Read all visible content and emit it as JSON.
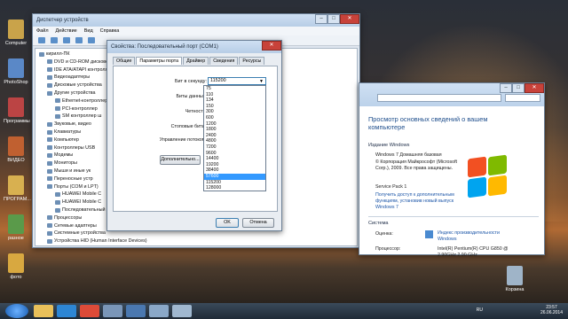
{
  "desktop": {
    "icons": [
      {
        "label": "Computer",
        "color": "#c9a34a"
      },
      {
        "label": "PhotoShop",
        "color": "#5a88c7"
      },
      {
        "label": "Программы",
        "color": "#b44"
      },
      {
        "label": "ВИДЕО",
        "color": "#c06030"
      },
      {
        "label": "ПРОГРАМ...",
        "color": "#d8b050"
      },
      {
        "label": "разное",
        "color": "#5a9a4a"
      },
      {
        "label": "фото",
        "color": "#d8a840"
      }
    ],
    "recycle": "Корзина"
  },
  "device_manager": {
    "title": "Диспетчер устройств",
    "menu": [
      "Файл",
      "Действие",
      "Вид",
      "Справка"
    ],
    "tree": [
      {
        "t": "кирилл-ПК",
        "d": 0
      },
      {
        "t": "DVD и CD-ROM дисководы",
        "d": 1
      },
      {
        "t": "IDE ATA/ATAPI контроллеры",
        "d": 1
      },
      {
        "t": "Видеоадаптеры",
        "d": 1
      },
      {
        "t": "Дисковые устройства",
        "d": 1
      },
      {
        "t": "Другие устройства",
        "d": 1
      },
      {
        "t": "Ethernet-контроллер",
        "d": 2
      },
      {
        "t": "PCI-контроллер",
        "d": 2
      },
      {
        "t": "SM контроллер ш",
        "d": 2
      },
      {
        "t": "Звуковые, видео",
        "d": 1
      },
      {
        "t": "Клавиатуры",
        "d": 1
      },
      {
        "t": "Компьютер",
        "d": 1
      },
      {
        "t": "Контроллеры USB",
        "d": 1
      },
      {
        "t": "Модемы",
        "d": 1
      },
      {
        "t": "Мониторы",
        "d": 1
      },
      {
        "t": "Мыши и иные ук",
        "d": 1
      },
      {
        "t": "Переносные устр",
        "d": 1
      },
      {
        "t": "Порты (COM и LPT)",
        "d": 1
      },
      {
        "t": "HUAWEI Mobile C",
        "d": 2
      },
      {
        "t": "HUAWEI Mobile C",
        "d": 2
      },
      {
        "t": "Последовательный",
        "d": 2
      },
      {
        "t": "Процессоры",
        "d": 1
      },
      {
        "t": "Сетевые адаптеры",
        "d": 1
      },
      {
        "t": "Системные устройства",
        "d": 1
      },
      {
        "t": "Устройства HID (Human Interface Devices)",
        "d": 1
      }
    ]
  },
  "props": {
    "title": "Свойства: Последовательный порт (COM1)",
    "tabs": [
      "Общие",
      "Параметры порта",
      "Драйвер",
      "Сведения",
      "Ресурсы"
    ],
    "labels": {
      "bps": "Бит в секунду:",
      "data": "Биты данных:",
      "parity": "Четность:",
      "stop": "Стоповые биты:",
      "flow": "Управление потоком:"
    },
    "bps_value": "115200",
    "advanced": "Дополнительно...",
    "ok": "OK",
    "cancel": "Отмена",
    "options": [
      "75",
      "110",
      "134",
      "150",
      "300",
      "600",
      "1200",
      "1800",
      "2400",
      "4800",
      "7200",
      "9600",
      "14400",
      "19200",
      "38400",
      "57600",
      "115200",
      "128000"
    ],
    "selected_index": 15
  },
  "system": {
    "heading": "Просмотр основных сведений о вашем компьютере",
    "edition_h": "Издание Windows",
    "edition": "Windows 7 Домашняя базовая",
    "copyright": "© Корпорация Майкрософт (Microsoft Corp.), 2009. Все права защищены.",
    "sp": "Service Pack 1",
    "more": "Получить доступ к дополнительным функциям, установив новый выпуск Windows 7",
    "system_h": "Система",
    "rating_l": "Оценка:",
    "rating_v": "Индекс производительности Windows",
    "cpu_l": "Процессор:",
    "cpu_v": "Intel(R) Pentium(R) CPU G850 @ 2.90GHz   2.90 GHz"
  },
  "taskbar": {
    "lang": "RU",
    "time": "23:57",
    "date": "26.06.2014"
  }
}
